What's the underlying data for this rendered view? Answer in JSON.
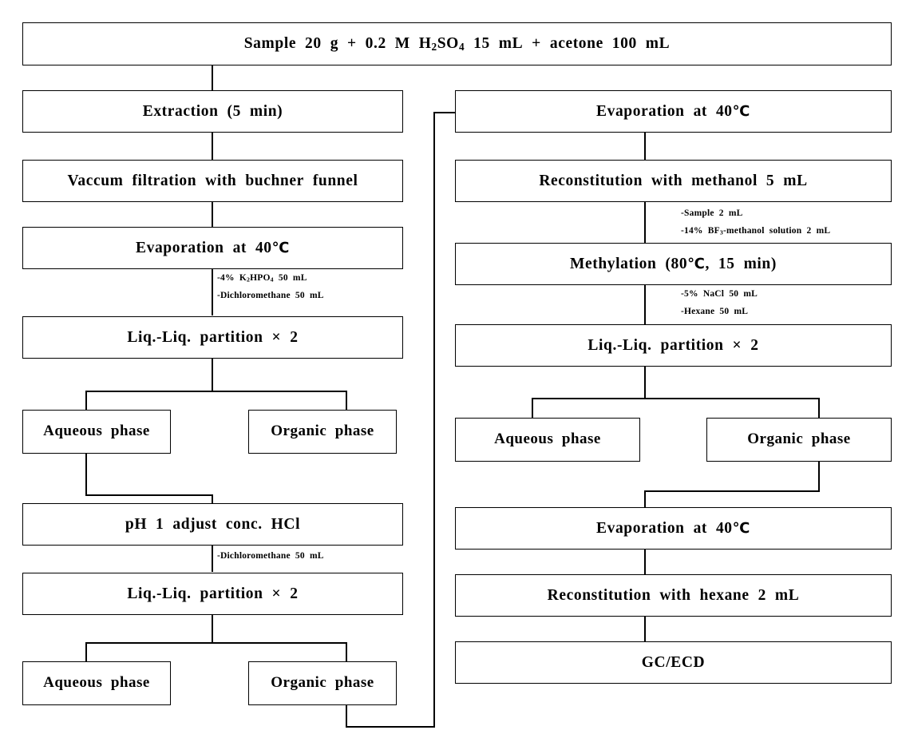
{
  "diagram": {
    "title": "Sample preparation flowchart for GC/ECD analysis",
    "line_color": "#000000",
    "box_border_color": "#000000",
    "background_color": "#ffffff"
  },
  "top": {
    "sample_box": "Sample 20 g + 0.2 M H2SO4 15 mL + acetone 100 mL"
  },
  "left_column": {
    "boxes": [
      {
        "id": "extraction",
        "label": "Extraction (5 min)"
      },
      {
        "id": "vacuum-filtration",
        "label": "Vaccum filtration with buchner funnel"
      },
      {
        "id": "evaporation-40",
        "label": "Evaporation at 40℃"
      },
      {
        "id": "liq-liq-partition-1",
        "label": "Liq.-Liq. partition × 2"
      },
      {
        "id": "aqueous-phase-1",
        "label": "Aqueous phase"
      },
      {
        "id": "organic-phase-1",
        "label": "Organic phase"
      },
      {
        "id": "ph-adjust",
        "label": "pH 1 adjust conc. HCl"
      },
      {
        "id": "liq-liq-partition-2",
        "label": "Liq.-Liq. partition × 2"
      },
      {
        "id": "aqueous-phase-2",
        "label": "Aqueous phase"
      },
      {
        "id": "organic-phase-2",
        "label": "Organic phase"
      }
    ],
    "notes": [
      {
        "id": "note-k2hpo4",
        "line1": "-4% K2HPO4 50 mL",
        "line2": "-Dichloromethane 50 mL"
      },
      {
        "id": "note-dcm",
        "line1": "-Dichloromethane 50 mL",
        "line2": ""
      }
    ]
  },
  "right_column": {
    "boxes": [
      {
        "id": "evaporation-40-r1",
        "label": "Evaporation at 40℃"
      },
      {
        "id": "reconstitution-methanol",
        "label": "Reconstitution with methanol 5 mL"
      },
      {
        "id": "methylation",
        "label": "Methylation (80℃, 15 min)"
      },
      {
        "id": "liq-liq-partition-3",
        "label": "Liq.-Liq. partition × 2"
      },
      {
        "id": "aqueous-phase-3",
        "label": "Aqueous phase"
      },
      {
        "id": "organic-phase-3",
        "label": "Organic phase"
      },
      {
        "id": "evaporation-40-r2",
        "label": "Evaporation at 40℃"
      },
      {
        "id": "reconstitution-hexane",
        "label": "Reconstitution with hexane 2 mL"
      },
      {
        "id": "gc-ecd",
        "label": "GC/ECD"
      }
    ],
    "notes": [
      {
        "id": "note-methylation",
        "line1": "-Sample 2 mL",
        "line2": "-14% BF3-methanol solution 2 mL"
      },
      {
        "id": "note-nacl",
        "line1": "-5% NaCl 50 mL",
        "line2": "-Hexane 50 mL"
      }
    ]
  }
}
